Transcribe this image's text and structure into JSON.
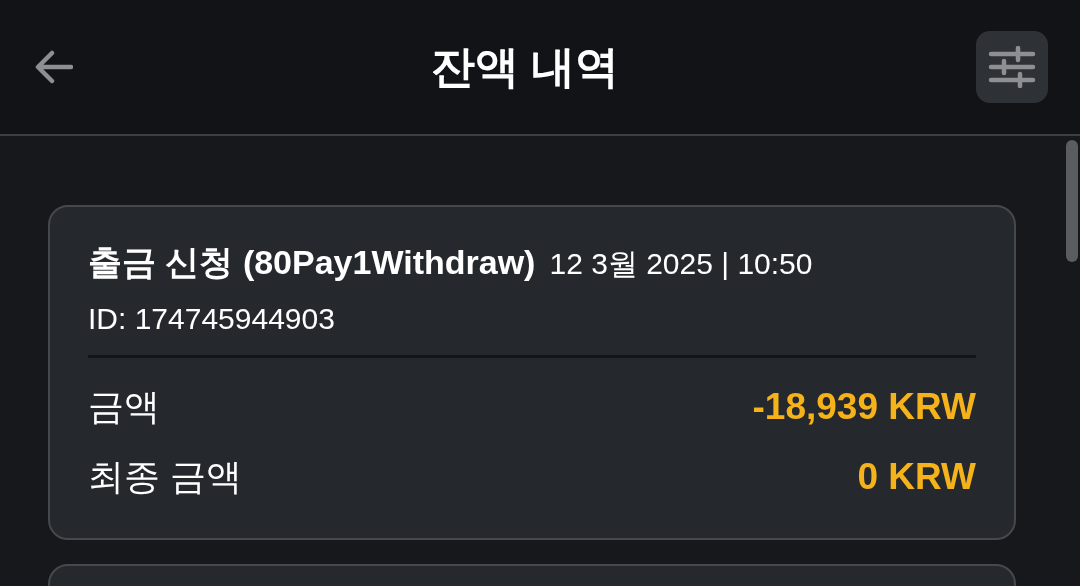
{
  "header": {
    "title": "잔액 내역"
  },
  "transactions": [
    {
      "title": "출금 신청 (80Pay1Withdraw)",
      "date": "12 3월 2025 | 10:50",
      "id": "ID: 174745944903",
      "rows": [
        {
          "label": "금액",
          "value": "-18,939 KRW"
        },
        {
          "label": "최종 금액",
          "value": "0 KRW"
        }
      ]
    }
  ]
}
